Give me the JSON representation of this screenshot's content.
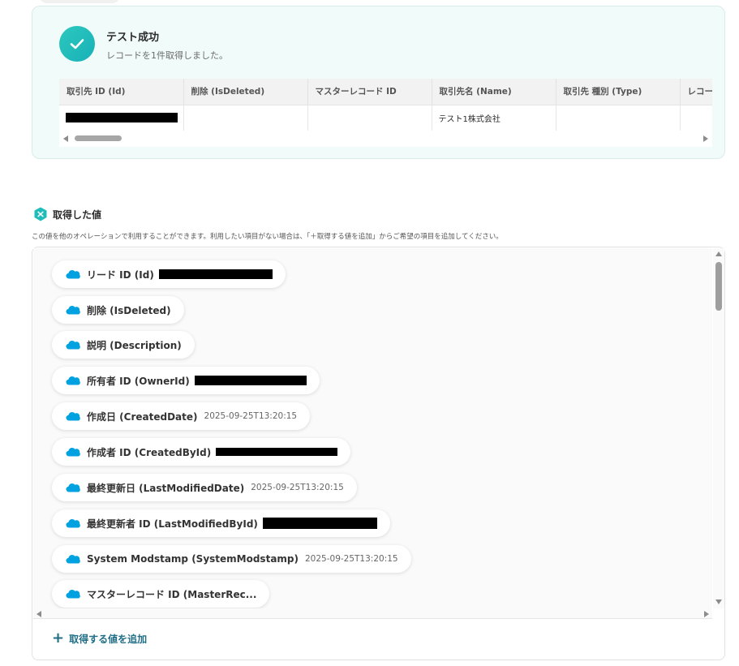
{
  "success": {
    "title": "テスト成功",
    "subtitle": "レコードを1件取得しました。"
  },
  "result_table": {
    "columns": [
      "取引先 ID (Id)",
      "削除 (IsDeleted)",
      "マスターレコード ID",
      "取引先名 (Name)",
      "取引先 種別 (Type)",
      "レコー"
    ],
    "row": [
      "",
      "",
      "",
      "テスト1株式会社",
      "",
      ""
    ]
  },
  "values_section": {
    "title": "取得した値",
    "description": "この値を他のオペレーションで利用することができます。利用したい項目がない場合は、「＋取得する値を追加」からご希望の項目を追加してください。",
    "items": [
      {
        "label": "リード ID (Id)",
        "value": ""
      },
      {
        "label": "削除 (IsDeleted)",
        "value": ""
      },
      {
        "label": "説明 (Description)",
        "value": ""
      },
      {
        "label": "所有者 ID (OwnerId)",
        "value": ""
      },
      {
        "label": "作成日 (CreatedDate)",
        "value": "2025-09-25T13:20:15"
      },
      {
        "label": "作成者 ID (CreatedById)",
        "value": ""
      },
      {
        "label": "最終更新日 (LastModifiedDate)",
        "value": "2025-09-25T13:20:15"
      },
      {
        "label": "最終更新者 ID (LastModifiedById)",
        "value": ""
      },
      {
        "label": "System Modstamp (SystemModstamp)",
        "value": "2025-09-25T13:20:15"
      },
      {
        "label": "マスターレコード ID (MasterRec...",
        "value": ""
      }
    ],
    "add_button": "取得する値を追加"
  },
  "icons": {
    "success": "check-icon",
    "section": "hexagon-x-icon",
    "chip": "salesforce-cloud-icon",
    "add": "plus-icon"
  },
  "colors": {
    "accent": "#1fbcb9",
    "salesforce": "#00a1e0",
    "link": "#1f6e85"
  }
}
